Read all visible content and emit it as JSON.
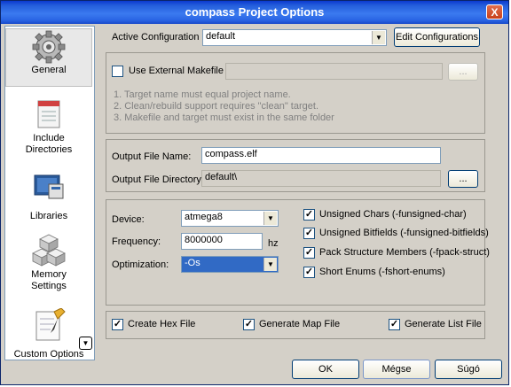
{
  "window": {
    "title": "compass Project Options",
    "close_label": "X"
  },
  "sidebar": {
    "items": [
      {
        "label": "General",
        "icon": "gear-icon",
        "selected": true
      },
      {
        "label": "Include\nDirectories",
        "icon": "include-directories-icon"
      },
      {
        "label": "Libraries",
        "icon": "libraries-icon"
      },
      {
        "label": "Memory\nSettings",
        "icon": "memory-settings-icon"
      },
      {
        "label": "Custom Options",
        "icon": "custom-options-icon"
      }
    ],
    "scroll_glyph": "▼"
  },
  "config": {
    "label": "Active Configuration",
    "value": "default",
    "edit_button": "Edit Configurations"
  },
  "makefile": {
    "checkbox_label": "Use External Makefile",
    "checked": false,
    "path_value": "",
    "browse_label": "...",
    "notes": [
      "1. Target name must equal project name.",
      "2. Clean/rebuild support requires  \"clean\" target.",
      "3. Makefile and target must exist in the same folder"
    ]
  },
  "output": {
    "file_label": "Output File Name:",
    "file_value": "compass.elf",
    "dir_label": "Output File Directory:",
    "dir_value": "default\\",
    "browse_label": "..."
  },
  "device": {
    "device_label": "Device:",
    "device_value": "atmega8",
    "frequency_label": "Frequency:",
    "frequency_value": "8000000",
    "frequency_unit": "hz",
    "optimization_label": "Optimization:",
    "optimization_value": "-Os"
  },
  "compiler_flags": [
    {
      "label": "Unsigned Chars (-funsigned-char)",
      "checked": true
    },
    {
      "label": "Unsigned Bitfields (-funsigned-bitfields)",
      "checked": true
    },
    {
      "label": "Pack Structure Members (-fpack-struct)",
      "checked": true
    },
    {
      "label": "Short Enums (-fshort-enums)",
      "checked": true
    }
  ],
  "generate": {
    "hex_label": "Create Hex File",
    "map_label": "Generate Map File",
    "list_label": "Generate List File",
    "check_glyph": "✓"
  },
  "footer": {
    "ok": "OK",
    "cancel": "Mégse",
    "help": "Súgó"
  }
}
